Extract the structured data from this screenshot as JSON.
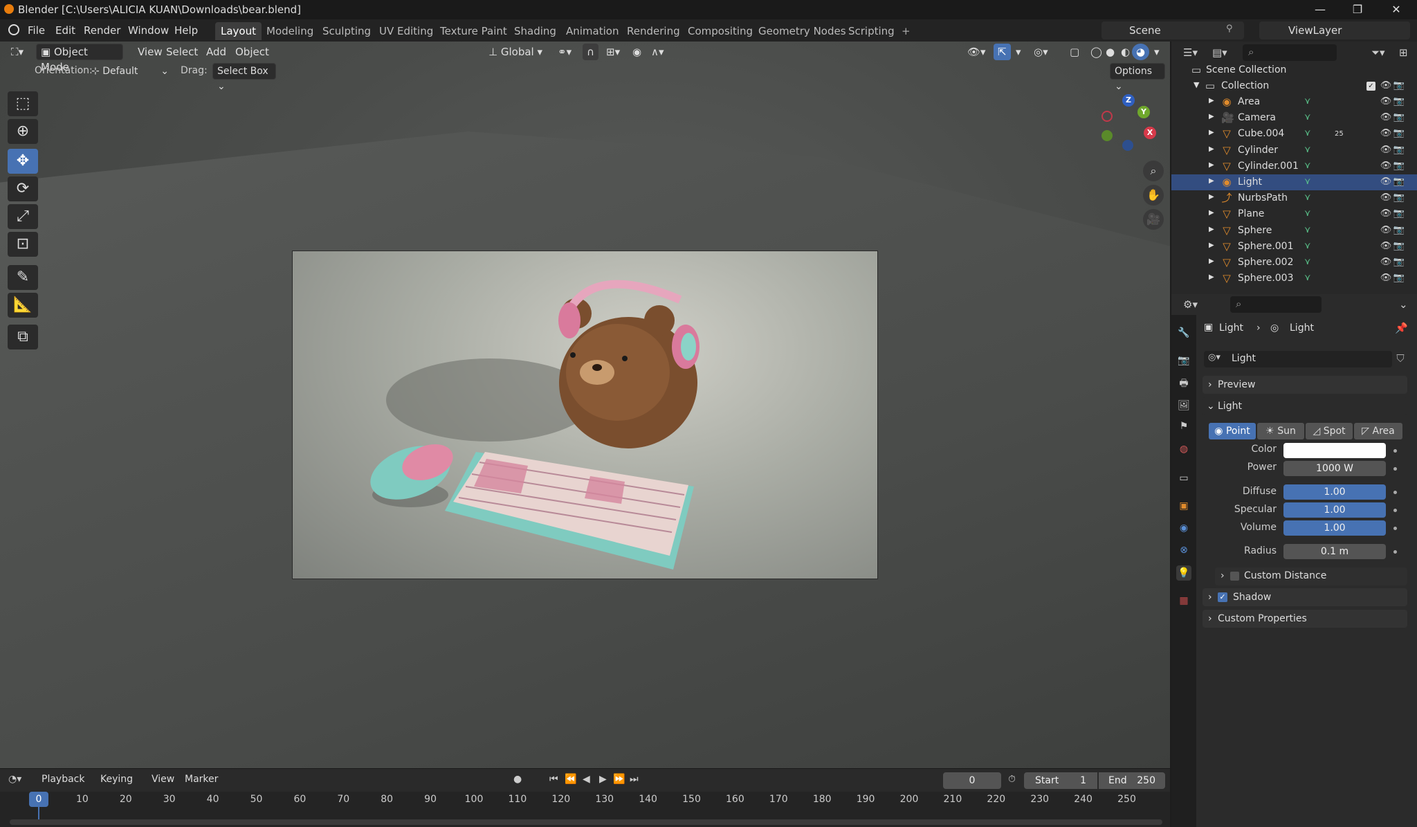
{
  "window": {
    "title": "Blender [C:\\Users\\ALICIA KUAN\\Downloads\\bear.blend]",
    "minimize": "—",
    "maximize": "❐",
    "close": "✕"
  },
  "menu": {
    "items": [
      "File",
      "Edit",
      "Render",
      "Window",
      "Help"
    ]
  },
  "workspaces": {
    "tabs": [
      "Layout",
      "Modeling",
      "Sculpting",
      "UV Editing",
      "Texture Paint",
      "Shading",
      "Animation",
      "Rendering",
      "Compositing",
      "Geometry Nodes",
      "Scripting"
    ],
    "active": "Layout",
    "add": "+"
  },
  "scene": {
    "name": "Scene",
    "view_layer": "ViewLayer"
  },
  "viewport": {
    "mode": "Object Mode",
    "menus": [
      "View",
      "Select",
      "Add",
      "Object"
    ],
    "transform_orientation": "Global",
    "orientation_label": "Orientation:",
    "orientation_value": "Default",
    "drag_label": "Drag:",
    "drag_value": "Select Box",
    "options": "Options",
    "gizmo": {
      "z": "Z",
      "y": "Y",
      "x": "X"
    }
  },
  "outliner": {
    "root": "Scene Collection",
    "collection": "Collection",
    "objects": [
      {
        "name": "Area",
        "icon": "light-icon",
        "selected": false
      },
      {
        "name": "Camera",
        "icon": "camera-icon",
        "selected": false
      },
      {
        "name": "Cube.004",
        "icon": "mesh-icon",
        "selected": false,
        "badge": "25"
      },
      {
        "name": "Cylinder",
        "icon": "mesh-icon",
        "selected": false
      },
      {
        "name": "Cylinder.001",
        "icon": "mesh-icon",
        "selected": false
      },
      {
        "name": "Light",
        "icon": "light-icon",
        "selected": true
      },
      {
        "name": "NurbsPath",
        "icon": "curve-icon",
        "selected": false
      },
      {
        "name": "Plane",
        "icon": "mesh-icon",
        "selected": false
      },
      {
        "name": "Sphere",
        "icon": "mesh-icon",
        "selected": false
      },
      {
        "name": "Sphere.001",
        "icon": "mesh-icon",
        "selected": false
      },
      {
        "name": "Sphere.002",
        "icon": "mesh-icon",
        "selected": false
      },
      {
        "name": "Sphere.003",
        "icon": "mesh-icon",
        "selected": false
      }
    ]
  },
  "properties": {
    "breadcrumb": [
      "Light",
      "Light"
    ],
    "datablock": "Light",
    "panels": {
      "preview": "Preview",
      "light": "Light",
      "custom_distance": "Custom Distance",
      "shadow": "Shadow",
      "custom_properties": "Custom Properties"
    },
    "light_types": [
      "Point",
      "Sun",
      "Spot",
      "Area"
    ],
    "active_type": "Point",
    "color_label": "Color",
    "color_value": "#ffffff",
    "power_label": "Power",
    "power": "1000 W",
    "diffuse_label": "Diffuse",
    "diffuse": "1.00",
    "specular_label": "Specular",
    "specular": "1.00",
    "volume_label": "Volume",
    "volume": "1.00",
    "radius_label": "Radius",
    "radius": "0.1 m",
    "shadow_checked": true,
    "custom_distance_checked": false
  },
  "timeline": {
    "menus": [
      "Playback",
      "Keying",
      "View",
      "Marker"
    ],
    "current_frame": "0",
    "start_label": "Start",
    "start": "1",
    "end_label": "End",
    "end": "250",
    "ticks": [
      "0",
      "10",
      "20",
      "30",
      "40",
      "50",
      "60",
      "70",
      "80",
      "90",
      "100",
      "110",
      "120",
      "130",
      "140",
      "150",
      "160",
      "170",
      "180",
      "190",
      "200",
      "210",
      "220",
      "230",
      "240",
      "250"
    ]
  },
  "colors": {
    "accent": "#4772b3",
    "selection": "#334d80",
    "object_orange": "#e08b2c"
  }
}
